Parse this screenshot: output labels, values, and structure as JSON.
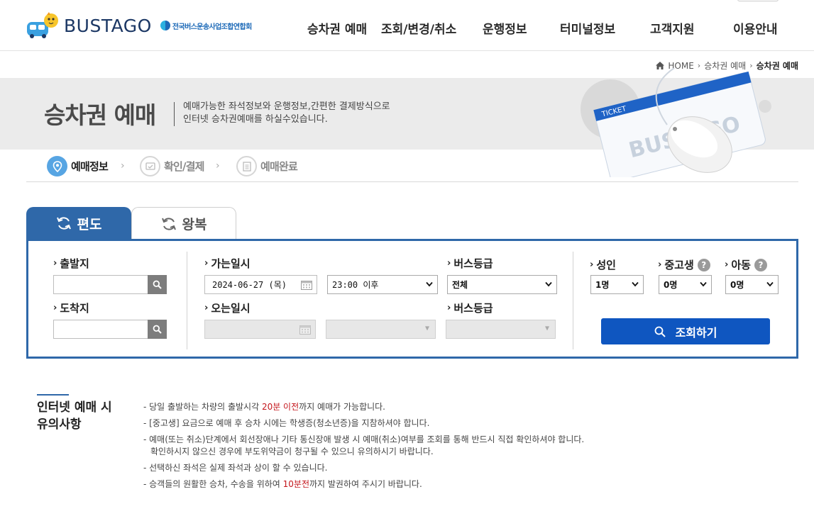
{
  "header": {
    "logo_text": "BUSTAGO",
    "assoc_text": "전국버스운송사업조합연합회",
    "nav": [
      "승차권 예매",
      "조회/변경/취소",
      "운행정보",
      "터미널정보",
      "고객지원",
      "이용안내"
    ]
  },
  "breadcrumb": {
    "home": "HOME",
    "parent": "승차권 예매",
    "current": "승차권 예매"
  },
  "hero": {
    "title": "승차권 예매",
    "desc_line1": "예매가능한 좌석정보와 운행정보,간편한 결제방식으로",
    "desc_line2": "인터넷 승차권예매를 하실수있습니다.",
    "ticket_label": "TICKET",
    "ticket_brand": "BUSTAGO"
  },
  "steps": [
    {
      "label": "예매정보",
      "state": "active",
      "icon": "map-pin-icon"
    },
    {
      "label": "확인/결제",
      "state": "inactive",
      "icon": "card-check-icon"
    },
    {
      "label": "예매완료",
      "state": "inactive",
      "icon": "document-icon"
    }
  ],
  "tabs": {
    "oneway": "편도",
    "roundtrip": "왕복",
    "selected": "편도"
  },
  "form": {
    "departure_label": "출발지",
    "arrival_label": "도착지",
    "departure_value": "",
    "arrival_value": "",
    "go_date_label": "가는일시",
    "go_date_value": "2024-06-27 (목)",
    "go_time_value": "23:00 이후",
    "go_grade_label": "버스등급",
    "go_grade_value": "전체",
    "return_date_label": "오는일시",
    "return_grade_label": "버스등급",
    "adult_label": "성인",
    "adult_value": "1명",
    "student_label": "중고생",
    "student_value": "0명",
    "child_label": "아동",
    "child_value": "0명",
    "help_symbol": "?",
    "query_button": "조회하기"
  },
  "notice": {
    "title_line1": "인터넷 예매 시",
    "title_line2": "유의사항",
    "items": [
      {
        "before": "- 당일 출발하는 차량의 출발시각 ",
        "highlight": "20분 이전",
        "after": "까지 예매가 가능합니다."
      },
      {
        "before": "- [중고생] 요금으로 예매 후 승차 시에는 학생증(청소년증)을 지참하셔야 합니다.",
        "highlight": "",
        "after": ""
      },
      {
        "before": "- 예매(또는 취소)단계에서 회선장애나 기타 통신장애 발생 시 예매(취소)여부를 조회를 통해 반드시 직접 확인하셔야 합니다.",
        "highlight": "",
        "after": "",
        "line2": "확인하시지 않으신 경우에 부도위약금이 청구될 수 있으니 유의하시기 바랍니다."
      },
      {
        "before": "- 선택하신 좌석은 실제 좌석과 상이 할 수 있습니다.",
        "highlight": "",
        "after": ""
      },
      {
        "before": "- 승객들의 원활한 승차, 수송을 위하여 ",
        "highlight": "10분전",
        "after": "까지 발권하여 주시기 바랍니다."
      }
    ]
  },
  "colors": {
    "brand_blue": "#2f68a9",
    "button_blue": "#0f56c0",
    "step_active": "#57a5e3",
    "highlight_red": "#c4161c"
  }
}
